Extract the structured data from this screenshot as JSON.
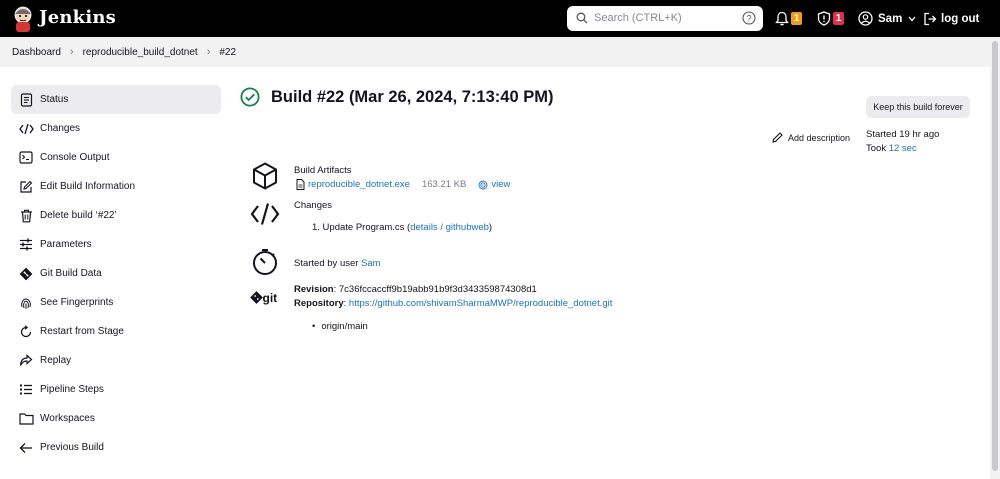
{
  "header": {
    "brand": "Jenkins",
    "search_placeholder": "Search (CTRL+K)",
    "notifications_count": "1",
    "security_count": "1",
    "user": "Sam",
    "logout": "log out"
  },
  "breadcrumb": [
    "Dashboard",
    "reproducible_build_dotnet",
    "#22"
  ],
  "sidebar": {
    "items": [
      {
        "label": "Status",
        "icon": "document-icon"
      },
      {
        "label": "Changes",
        "icon": "code-icon"
      },
      {
        "label": "Console Output",
        "icon": "terminal-icon"
      },
      {
        "label": "Edit Build Information",
        "icon": "edit-icon"
      },
      {
        "label": "Delete build ‘#22’",
        "icon": "trash-icon"
      },
      {
        "label": "Parameters",
        "icon": "sliders-icon"
      },
      {
        "label": "Git Build Data",
        "icon": "git-icon"
      },
      {
        "label": "See Fingerprints",
        "icon": "fingerprint-icon"
      },
      {
        "label": "Restart from Stage",
        "icon": "restart-icon"
      },
      {
        "label": "Replay",
        "icon": "replay-icon"
      },
      {
        "label": "Pipeline Steps",
        "icon": "list-icon"
      },
      {
        "label": "Workspaces",
        "icon": "folder-icon"
      },
      {
        "label": "Previous Build",
        "icon": "arrow-left-icon"
      }
    ]
  },
  "build": {
    "title": "Build #22 (Mar 26, 2024, 7:13:40 PM)",
    "keep_button": "Keep this build forever",
    "add_description": "Add description",
    "started": "Started 19 hr ago",
    "took_prefix": "Took ",
    "took_value": "12 sec"
  },
  "artifacts": {
    "heading": "Build Artifacts",
    "file": "reproducible_dotnet.exe",
    "size": "163.21 KB",
    "view": "view"
  },
  "changes": {
    "heading": "Changes",
    "item_prefix": "1. Update Program.cs (",
    "details": "details",
    "slash": " / ",
    "githubweb": "githubweb",
    "item_suffix": ")"
  },
  "started_by": {
    "prefix": "Started by user ",
    "user": "Sam"
  },
  "git": {
    "label": "git",
    "revision_label": "Revision",
    "revision": "7c36fccaccff9b19abb91b9f3d343359874308d1",
    "repository_label": "Repository",
    "repository": "https://github.com/shivamSharmaMWP/reproducible_dotnet.git",
    "branch": "origin/main"
  },
  "colors": {
    "accent": "#1a73c8",
    "success": "#138347",
    "header": "#000000"
  }
}
